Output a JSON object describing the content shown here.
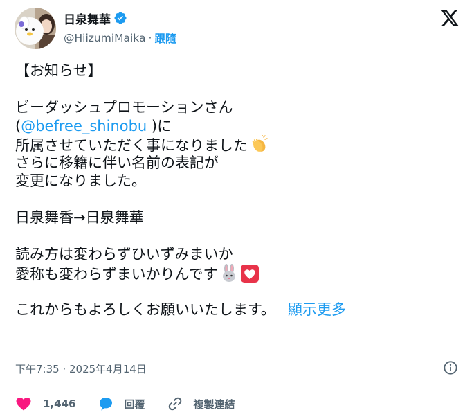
{
  "author": {
    "display_name": "日泉舞華",
    "handle": "@HiizumiMaika",
    "separator": "·",
    "follow_label": "跟隨"
  },
  "post": {
    "lines": {
      "l1": "【お知らせ】",
      "l2": "ビーダッシュプロモーションさん",
      "l3_open": "(",
      "l3_mention": "@befree_shinobu",
      "l3_close": " )に",
      "l4": "所属させていただく事になりました",
      "l5": "さらに移籍に伴い名前の表記が",
      "l6": "変更になりました。",
      "l7": "日泉舞香→日泉舞華",
      "l8": "読み方は変わらずひいずみまいか",
      "l9": "愛称も変わらずまいかりんです",
      "l10": "これからもよろしくお願いいたします。"
    },
    "show_more": "顯示更多",
    "emojis": [
      "clapping-hands",
      "rabbit-face",
      "heart"
    ],
    "timestamp": "下午7:35 · 2025年4月14日"
  },
  "actions": {
    "like_count": "1,446",
    "reply_label": "回覆",
    "copy_link_label": "複製連結"
  },
  "colors": {
    "accent": "#1d9bf0",
    "like": "#f91880",
    "text": "#0f1419",
    "secondary": "#536471"
  }
}
